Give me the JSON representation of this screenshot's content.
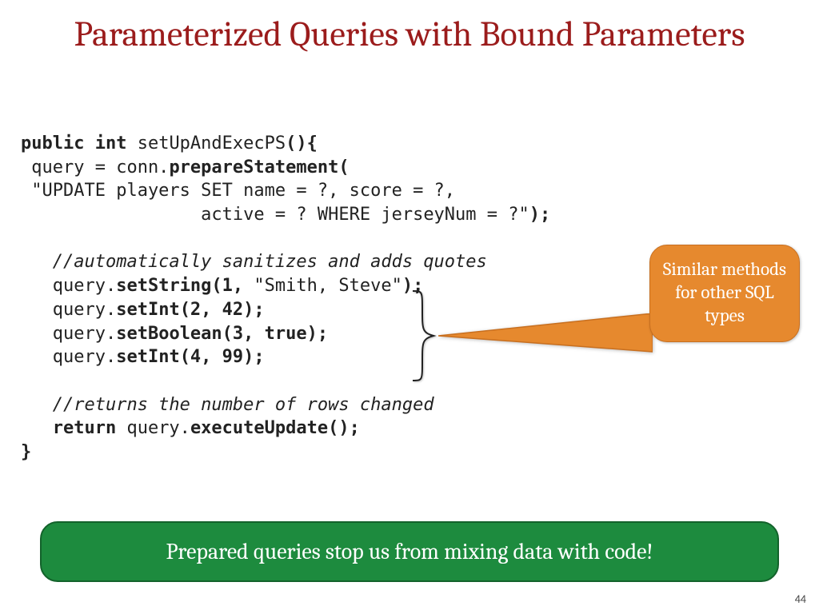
{
  "title": "Parameterized Queries with Bound Parameters",
  "code": {
    "l1a": "public int ",
    "l1b": "setUpAndExecPS",
    "l1c": "(){",
    "l2a": " query = conn.",
    "l2b": "prepareStatement(",
    "l3": " \"UPDATE players SET name = ?, score = ?,",
    "l4a": "                 active = ? WHERE jerseyNum = ?\"",
    "l4b": ");",
    "l5": "   //automatically sanitizes and adds quotes",
    "l6a": "   query.",
    "l6b": "setString(1, ",
    "l6c": "\"Smith, Steve\"",
    "l6d": ");",
    "l7a": "   query.",
    "l7b": "setInt(2, 42);",
    "l8a": "   query.",
    "l8b": "setBoolean(3, true);",
    "l9a": "   query.",
    "l9b": "setInt(4, 99);",
    "l10": "   //returns the number of rows changed",
    "l11a": "   return ",
    "l11b": "query.",
    "l11c": "executeUpdate();",
    "l12": "}"
  },
  "callout": "Similar methods for other SQL types",
  "footer": "Prepared queries stop us from mixing data with code!",
  "page_number": "44"
}
